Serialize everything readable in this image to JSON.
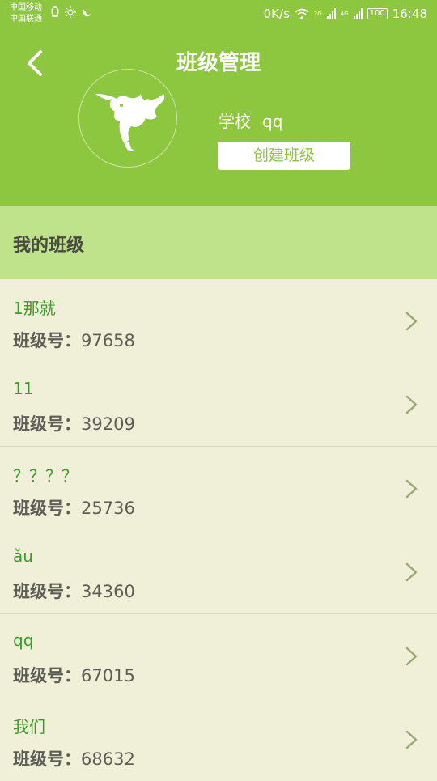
{
  "status_bar": {
    "carrier1": "中国移动",
    "carrier2": "中国联通",
    "speed": "0K/s",
    "sim1_tag": "2G",
    "sim2_tag": "4G",
    "battery": "100",
    "time": "16:48"
  },
  "header": {
    "title": "班级管理",
    "school_label": "学校",
    "school_value": "qq",
    "create_button": "创建班级"
  },
  "section": {
    "title": "我的班级"
  },
  "class_number_label": "班级号：",
  "classes": [
    {
      "name": "1那就",
      "number": "97658"
    },
    {
      "name": "11",
      "number": "39209"
    },
    {
      "name": "？？？？",
      "number": "25736"
    },
    {
      "name": "ǎu",
      "number": "34360"
    },
    {
      "name": "qq",
      "number": "67015"
    },
    {
      "name": "我们",
      "number": "68632"
    }
  ],
  "icons": [
    "qq-icon",
    "brightness-icon",
    "uc-browser-icon",
    "wifi-icon",
    "signal-icon",
    "battery-icon",
    "back-arrow-icon",
    "dragon-avatar",
    "chevron-right-icon"
  ],
  "colors": {
    "header_bg": "#8dc63f",
    "section_bg": "#bee38a",
    "list_bg": "#f0f0d8",
    "name_text": "#3a9a2a"
  }
}
